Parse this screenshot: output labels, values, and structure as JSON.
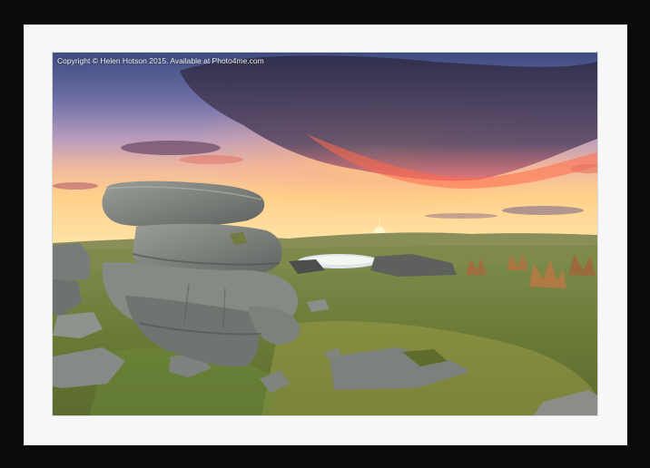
{
  "watermark": {
    "copyright_text": "Copyright © Helen Hotson 2015. Available at Photo4me.com"
  },
  "colors": {
    "frame": "#0b0b0b",
    "mount": "#f7f7f7",
    "sky_top": "#4a5a8c",
    "sun_glow": "#ffd27a",
    "cloud_dark": "#3c3550",
    "grass": "#7d8a3c",
    "rock": "#8a8f8c"
  }
}
